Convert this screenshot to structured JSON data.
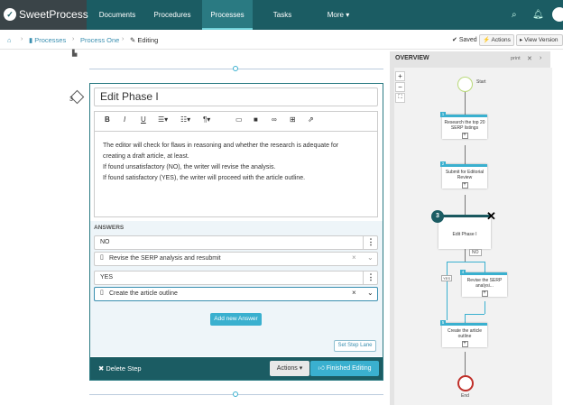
{
  "app": {
    "logo": "SweetProcess"
  },
  "nav": {
    "documents": "Documents",
    "procedures": "Procedures",
    "processes": "Processes",
    "tasks": "Tasks",
    "more": "More ▾"
  },
  "breadcrumb": {
    "processes": "Processes",
    "process": "Process One",
    "current": "Editing"
  },
  "toolbar": {
    "saved": "Saved",
    "actions": "Actions",
    "view_version": "View Version"
  },
  "editor": {
    "title": "Edit Phase I",
    "step_number": "3",
    "body": [
      "The editor will check for flaws in reasoning and whether the research is adequate for",
      "creating a draft article, at least.",
      "If found unsatisfactory (NO), the writer will revise the analysis.",
      "If found satisfactory (YES), the writer will proceed with the article outline."
    ],
    "answers_title": "ANSWERS",
    "answers": [
      {
        "label": "NO",
        "step": "Revise the SERP analysis and resubmit"
      },
      {
        "label": "YES",
        "step": "Create the article outline"
      }
    ],
    "add_answer": "Add new Answer",
    "set_step_lane": "Set Step Lane",
    "delete_step": "Delete Step",
    "actions": "Actions",
    "finished": "Finished Editing"
  },
  "overview": {
    "title": "OVERVIEW",
    "print": "print",
    "start": "Start",
    "end": "End",
    "nodes": [
      {
        "num": "1",
        "label": "Research the top 20 SERP listings"
      },
      {
        "num": "2",
        "label": "Submit for Editorial Review"
      },
      {
        "num": "3",
        "label": "Edit Phase I"
      },
      {
        "num": "4",
        "label": "Revise the SERP analysi..."
      },
      {
        "num": "5",
        "label": "Create the article outline"
      }
    ],
    "no": "NO",
    "yes": "YES"
  }
}
